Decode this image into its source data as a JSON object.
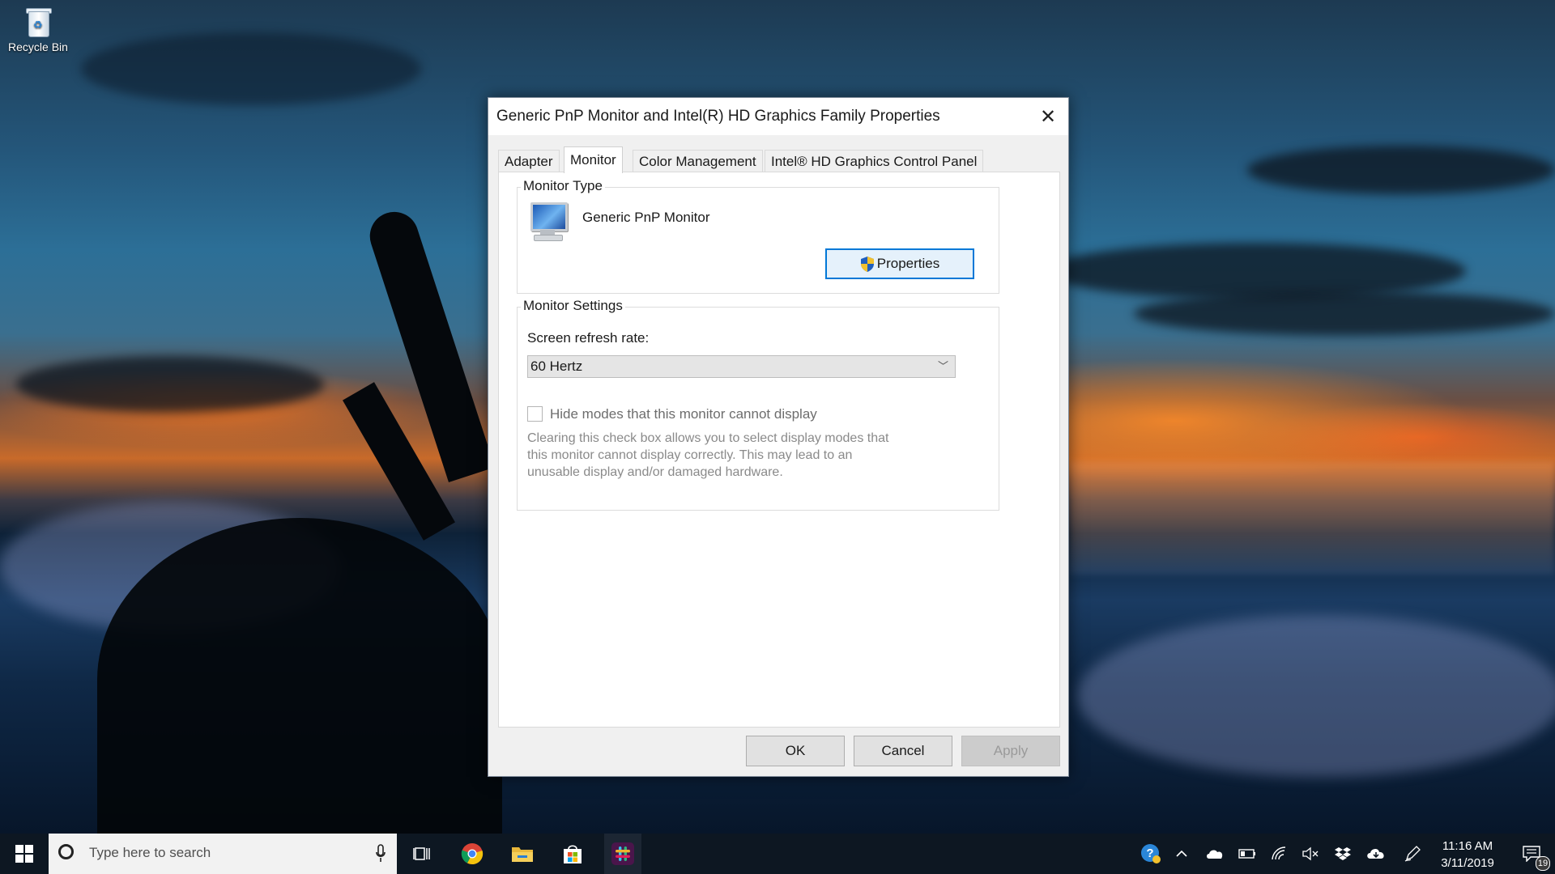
{
  "desktop": {
    "icons": [
      {
        "label": "Recycle Bin",
        "icon": "recycle-bin-icon"
      }
    ]
  },
  "dialog": {
    "title": "Generic PnP Monitor and Intel(R) HD Graphics Family Properties",
    "close_icon": "close-icon",
    "tabs": [
      {
        "label": "Adapter",
        "active": false
      },
      {
        "label": "Monitor",
        "active": true
      },
      {
        "label": "Color Management",
        "active": false
      },
      {
        "label": "Intel® HD Graphics Control Panel",
        "active": false
      }
    ],
    "monitor_type": {
      "legend": "Monitor Type",
      "monitor_name": "Generic PnP Monitor",
      "properties_button": "Properties"
    },
    "monitor_settings": {
      "legend": "Monitor Settings",
      "refresh_label": "Screen refresh rate:",
      "refresh_value": "60 Hertz",
      "hide_modes_label": "Hide modes that this monitor cannot display",
      "hide_modes_checked": false,
      "hint": "Clearing this check box allows you to select display modes that this monitor cannot display correctly. This may lead to an unusable display and/or damaged hardware."
    },
    "buttons": {
      "ok": "OK",
      "cancel": "Cancel",
      "apply": "Apply"
    }
  },
  "taskbar": {
    "search_placeholder": "Type here to search",
    "pinned": [
      "windows-start-icon",
      "task-view-icon",
      "chrome-icon",
      "file-explorer-icon",
      "microsoft-store-icon",
      "slack-icon"
    ],
    "tray": [
      "help-icon",
      "show-hidden-icons-chevron",
      "onedrive-icon",
      "battery-icon",
      "wifi-icon",
      "volume-muted-icon",
      "dropbox-icon",
      "cloud-icon",
      "pen-icon"
    ],
    "time": "11:16 AM",
    "date": "3/11/2019",
    "notification_count": "19"
  },
  "colors": {
    "accent": "#0078d7",
    "taskbar": "#0d1722",
    "dialog_bg": "#f0f0f0"
  }
}
